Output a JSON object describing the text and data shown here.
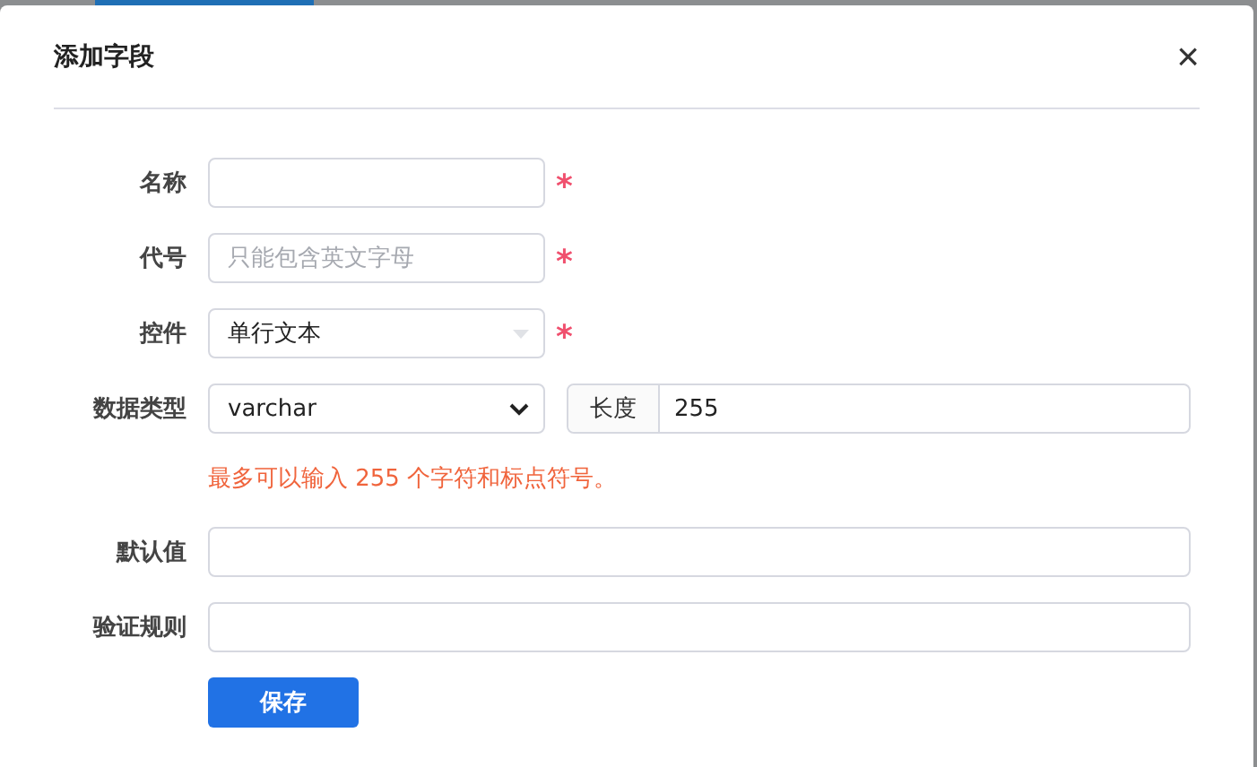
{
  "dialog": {
    "title": "添加字段",
    "close": "×"
  },
  "fields": [
    {
      "label": "名称",
      "kind": "text",
      "required_mark": "*"
    },
    {
      "label": "代号",
      "kind": "text",
      "placeholder": "只能包含英文字母",
      "required_mark": "*"
    },
    {
      "label": "控件",
      "kind": "combo",
      "value": "单行文本",
      "disabled": true,
      "required_mark": "*"
    },
    {
      "label": "数据类型",
      "kind": "select",
      "value": "varchar",
      "addon": {
        "label": "长度",
        "value": "255"
      }
    },
    {
      "kind": "hint",
      "text": "最多可以输入 255 个字符和标点符号。"
    },
    {
      "label": "默认值",
      "kind": "wide_text"
    },
    {
      "label": "验证规则",
      "kind": "wide_text"
    }
  ],
  "save_button": "保存"
}
